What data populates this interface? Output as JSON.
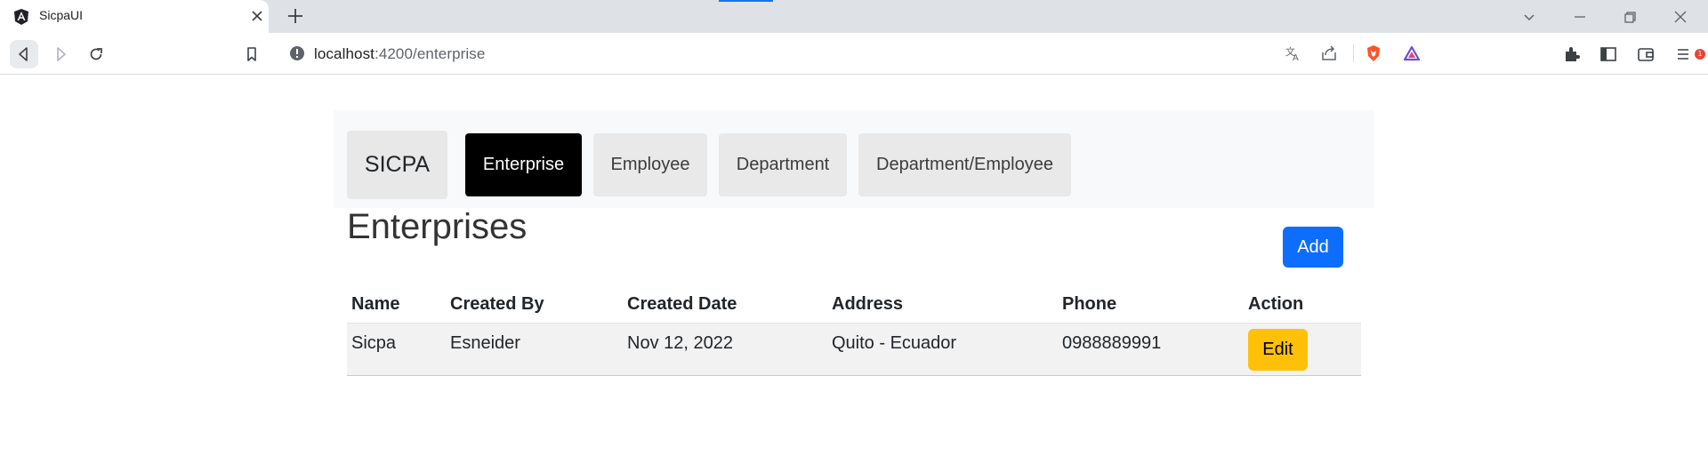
{
  "browser": {
    "tab_title": "SicpaUI",
    "url_host": "localhost",
    "url_path": ":4200/enterprise",
    "extension_badge": "1"
  },
  "nav": {
    "brand": "SICPA",
    "tabs": [
      {
        "label": "Enterprise",
        "active": true
      },
      {
        "label": "Employee",
        "active": false
      },
      {
        "label": "Department",
        "active": false
      },
      {
        "label": "Department/Employee",
        "active": false
      }
    ]
  },
  "page": {
    "title": "Enterprises",
    "add_label": "Add"
  },
  "table": {
    "headers": [
      "Name",
      "Created By",
      "Created Date",
      "Address",
      "Phone",
      "Action"
    ],
    "rows": [
      {
        "name": "Sicpa",
        "created_by": "Esneider",
        "created_date": "Nov 12, 2022",
        "address": "Quito - Ecuador",
        "phone": "0988889991",
        "action_label": "Edit"
      }
    ]
  },
  "colors": {
    "accent_primary": "#0d6efd",
    "accent_warning": "#ffc107",
    "active_tab": "#000000"
  }
}
